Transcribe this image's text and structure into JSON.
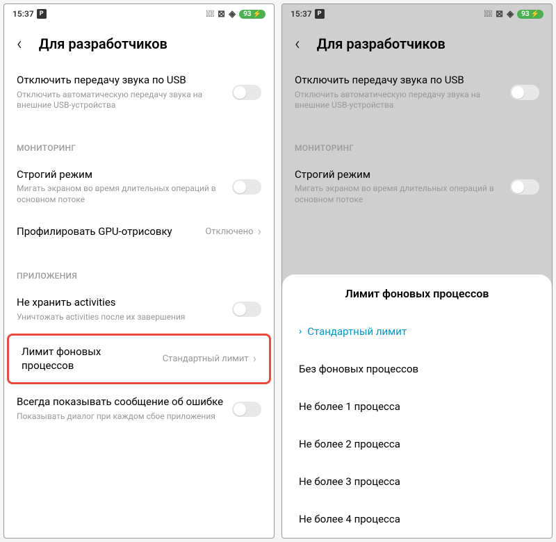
{
  "status": {
    "time": "15:37",
    "p_label": "P",
    "battery": "93",
    "bolt": "⚡"
  },
  "header": {
    "title": "Для разработчиков"
  },
  "settings": {
    "usb_audio": {
      "title": "Отключить передачу звука по USB",
      "sub": "Отключить автоматическую передачу звука на внешние USB-устройства"
    },
    "section_monitoring": "МОНИТОРИНГ",
    "strict_mode": {
      "title": "Строгий режим",
      "sub": "Мигать экраном во время длительных операций в основном потоке"
    },
    "gpu_profile": {
      "title": "Профилировать GPU-отрисовку",
      "value": "Отключено"
    },
    "section_apps": "ПРИЛОЖЕНИЯ",
    "no_keep": {
      "title": "Не хранить activities",
      "sub": "Уничтожать activities после их завершения"
    },
    "bg_limit": {
      "title": "Лимит фоновых процессов",
      "value": "Стандартный лимит"
    },
    "show_error": {
      "title": "Всегда показывать сообщение об ошибке",
      "sub": "Показывать диалог при каждом сбое приложения"
    }
  },
  "sheet": {
    "title": "Лимит фоновых процессов",
    "options": [
      "Стандартный лимит",
      "Без фоновых процессов",
      "Не более 1 процесса",
      "Не более 2 процесса",
      "Не более 3 процесса",
      "Не более 4 процесса"
    ]
  }
}
